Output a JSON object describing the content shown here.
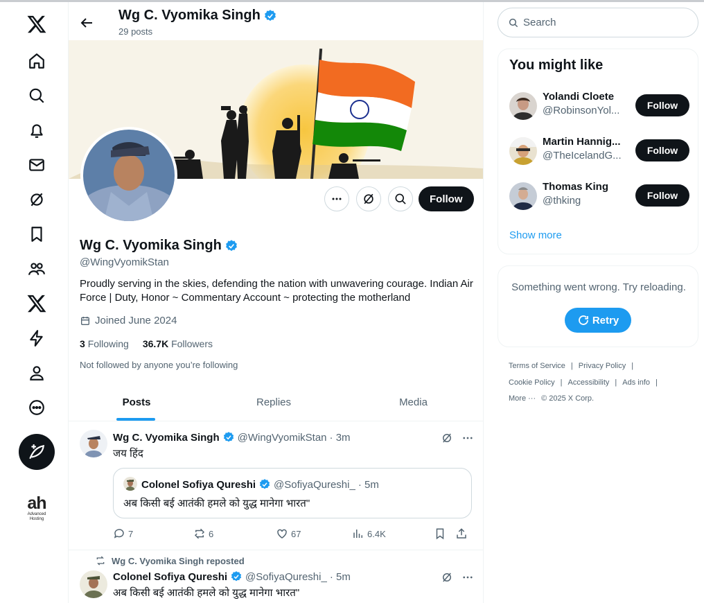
{
  "nav": {
    "items": [
      "x-logo",
      "home",
      "explore",
      "notifications",
      "messages",
      "grok",
      "bookmarks",
      "communities",
      "premium",
      "verified-orgs",
      "profile",
      "more"
    ],
    "compose": "post",
    "badge": {
      "big": "ah",
      "small1": "Advanced",
      "small2": "Hosting"
    }
  },
  "header": {
    "name": "Wg C. Vyomika Singh",
    "posts": "29 posts"
  },
  "profile": {
    "name": "Wg C. Vyomika Singh",
    "handle": "@WingVyomikStan",
    "bio": "Proudly serving in the skies, defending the nation with unwavering courage. Indian Air Force | Duty, Honor ~ Commentary Account ~  protecting the motherland",
    "joined": "Joined June 2024",
    "following_count": "3",
    "following_label": "Following",
    "followers_count": "36.7K",
    "followers_label": "Followers",
    "not_followed": "Not followed by anyone you’re following",
    "follow_label": "Follow"
  },
  "tabs": [
    {
      "label": "Posts"
    },
    {
      "label": "Replies"
    },
    {
      "label": "Media"
    }
  ],
  "tweet1": {
    "name": "Wg C. Vyomika Singh",
    "handle": "@WingVyomikStan",
    "time": "· 3m",
    "text": "जय हिंद",
    "quote": {
      "name": "Colonel Sofiya Qureshi",
      "handle": "@SofiyaQureshi_",
      "time": "· 5m",
      "text": "अब किसी बई आतंकी हमले को युद्ध मानेगा भारत\""
    },
    "stats": {
      "replies": "7",
      "reposts": "6",
      "likes": "67",
      "views": "6.4K"
    }
  },
  "tweet2": {
    "repost_label": "Wg C. Vyomika Singh reposted",
    "name": "Colonel Sofiya Qureshi",
    "handle": "@SofiyaQureshi_",
    "time": "· 5m",
    "text": "अब किसी बई आतंकी हमले को युद्ध मानेगा भारत\""
  },
  "search": {
    "placeholder": "Search"
  },
  "suggestions": {
    "title": "You might like",
    "users": [
      {
        "name": "Yolandi Cloete",
        "handle": "@RobinsonYol...",
        "button": "Follow"
      },
      {
        "name": "Martin Hannig...",
        "handle": "@TheIcelandG...",
        "button": "Follow"
      },
      {
        "name": "Thomas King",
        "handle": "@thking",
        "button": "Follow"
      }
    ],
    "show_more": "Show more"
  },
  "error": {
    "text": "Something went wrong. Try reloading.",
    "retry": "Retry"
  },
  "footer": {
    "terms": "Terms of Service",
    "privacy": "Privacy Policy",
    "cookie": "Cookie Policy",
    "accessibility": "Accessibility",
    "ads": "Ads info",
    "more": "More ···",
    "copyright": "© 2025 X Corp."
  },
  "colors": {
    "accent": "#1d9bf0",
    "text": "#0f1419",
    "muted": "#536471",
    "verified": "#1d9bf0"
  }
}
